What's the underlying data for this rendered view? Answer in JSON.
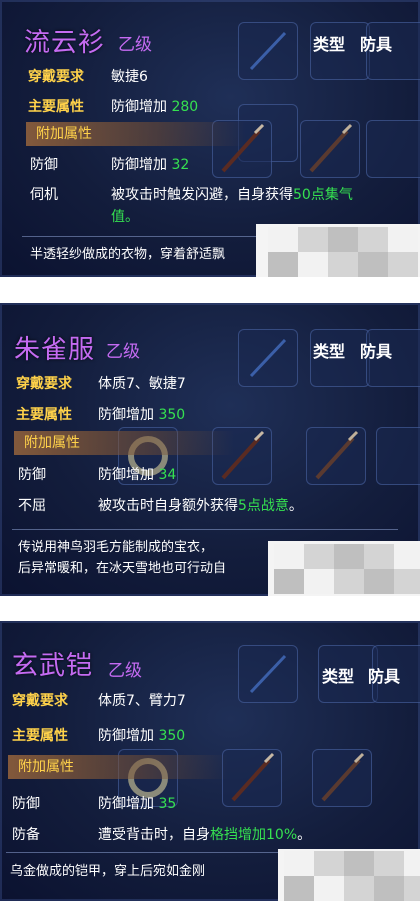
{
  "items": [
    {
      "name": "流云衫",
      "grade": "乙级",
      "type_label": "类型",
      "type_value": "防具",
      "req_label": "穿戴要求",
      "req_value": "敏捷6",
      "main_label": "主要属性",
      "main_text": "防御增加",
      "main_value": "280",
      "extra_header": "附加属性",
      "attrs": [
        {
          "label": "防御",
          "text": "防御增加",
          "value": "32"
        },
        {
          "label": "伺机",
          "text": "被攻击时触发闪避，自身获得",
          "value": "50点集气",
          "line2": "值。"
        }
      ],
      "description": "半透轻纱做成的衣物，穿着舒适飘"
    },
    {
      "name": "朱雀服",
      "grade": "乙级",
      "type_label": "类型",
      "type_value": "防具",
      "req_label": "穿戴要求",
      "req_value": "体质7、敏捷7",
      "main_label": "主要属性",
      "main_text": "防御增加",
      "main_value": "350",
      "extra_header": "附加属性",
      "attrs": [
        {
          "label": "防御",
          "text": "防御增加",
          "value": "34"
        },
        {
          "label": "不屈",
          "text": "被攻击时自身额外获得",
          "value": "5点战意",
          "suffix": "。"
        }
      ],
      "description": "传说用神鸟羽毛方能制成的宝衣，",
      "description_line2": "后异常暖和，在冰天雪地也可行动自"
    },
    {
      "name": "玄武铠",
      "grade": "乙级",
      "type_label": "类型",
      "type_value": "防具",
      "req_label": "穿戴要求",
      "req_value": "体质7、臂力7",
      "main_label": "主要属性",
      "main_text": "防御增加",
      "main_value": "350",
      "extra_header": "附加属性",
      "attrs": [
        {
          "label": "防御",
          "text": "防御增加",
          "value": "35"
        },
        {
          "label": "防备",
          "text": "遭受背击时，自身",
          "value": "格挡增加10%",
          "suffix": "。"
        }
      ],
      "description": "乌金做成的铠甲，穿上后宛如金刚"
    }
  ],
  "colors": {
    "title": "#c56bf2",
    "requirement_label": "#ffd24a",
    "value_green": "#35e050",
    "panel_bg": "#131d3c"
  }
}
